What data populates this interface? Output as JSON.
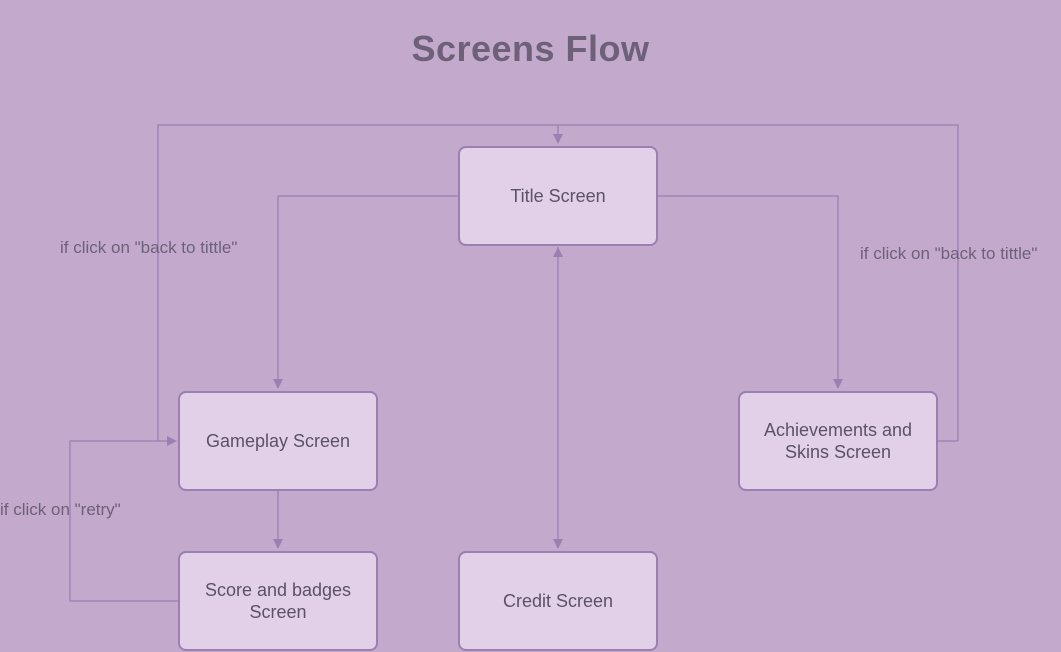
{
  "title": "Screens Flow",
  "nodes": {
    "title_screen": "Title Screen",
    "gameplay_screen": "Gameplay Screen",
    "score_screen": "Score and badges Screen",
    "credit_screen": "Credit Screen",
    "achievements_screen": "Achievements and Skins Screen"
  },
  "labels": {
    "back_left": "if click on \"back to tittle\"",
    "back_right": "if click on \"back to tittle\"",
    "retry": "if click on \"retry\""
  }
}
